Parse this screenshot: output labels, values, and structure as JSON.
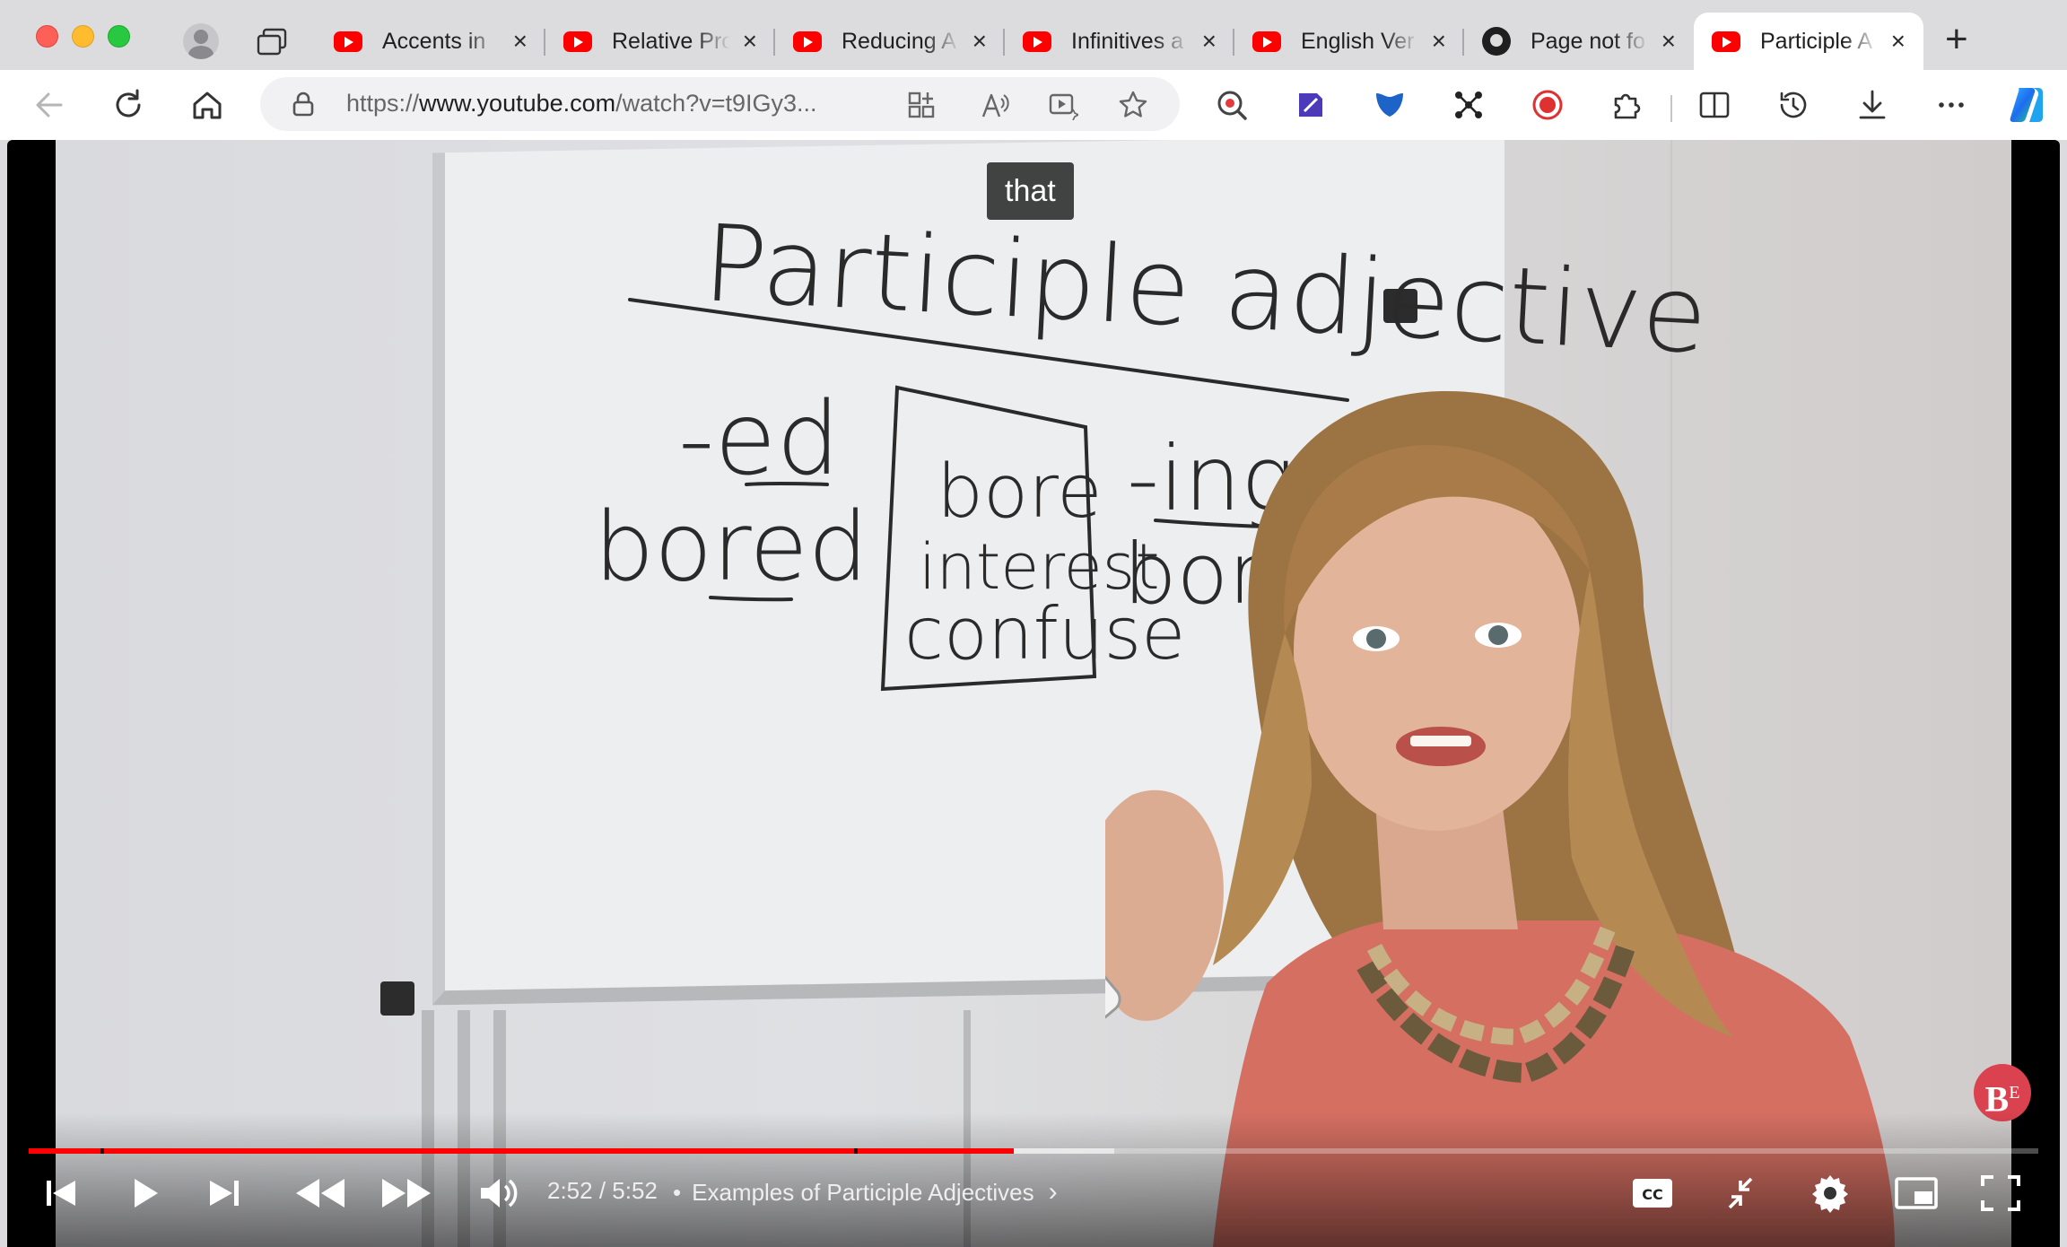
{
  "browser": {
    "tabs": [
      {
        "title": "Accents in",
        "icon": "youtube-icon",
        "active": false
      },
      {
        "title": "Relative Pro",
        "icon": "youtube-icon",
        "active": false
      },
      {
        "title": "Reducing A",
        "icon": "youtube-icon",
        "active": false
      },
      {
        "title": "Infinitives a",
        "icon": "youtube-icon",
        "active": false
      },
      {
        "title": "English Ver",
        "icon": "youtube-icon",
        "active": false
      },
      {
        "title": "Page not fo",
        "icon": "github-icon",
        "active": false
      },
      {
        "title": "Participle A",
        "icon": "youtube-icon",
        "active": true
      }
    ],
    "close_glyph": "×",
    "new_tab_glyph": "+",
    "address": {
      "scheme": "https://",
      "host": "www.youtube.com",
      "path": "/watch?v=t9IGy3..."
    }
  },
  "video": {
    "caption": "that",
    "board_text": {
      "title": "Participle adjective",
      "ed_header": "-ed",
      "ed_word": "bored",
      "box_words": [
        "bore",
        "interest",
        "confuse"
      ],
      "ing_header": "-ing",
      "ing_word": "boring"
    },
    "watermark": "B",
    "watermark_sup": "E",
    "player": {
      "current_time": "2:52",
      "duration": "5:52",
      "time_separator": " / ",
      "chapter_dot": "•",
      "chapter_title": "Examples of Participle Adjectives",
      "progress_played": 0.49,
      "progress_buffered": 0.54
    }
  },
  "colors": {
    "youtube_red": "#ff0000",
    "tab_bar": "#dcdcde",
    "toolbar": "#ffffff",
    "captions_bg": "rgba(8,8,8,0.75)"
  }
}
